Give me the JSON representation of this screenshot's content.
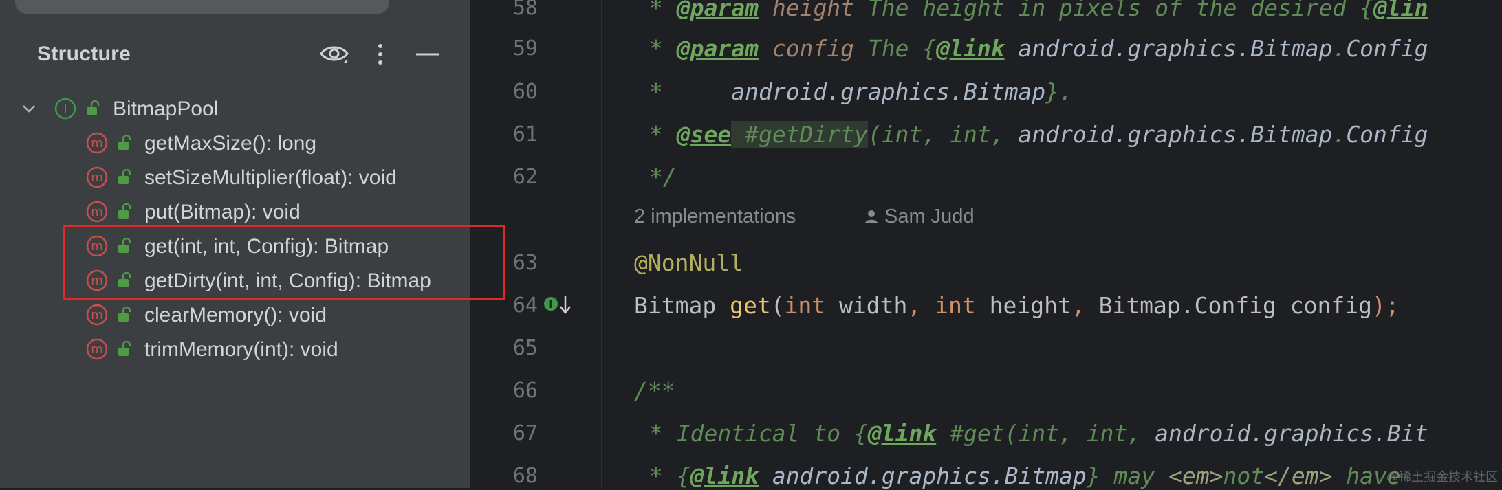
{
  "structure": {
    "title": "Structure",
    "root": {
      "label": "BitmapPool",
      "kind": "interface-icon"
    },
    "members": [
      {
        "label": "getMaxSize(): long"
      },
      {
        "label": "setSizeMultiplier(float): void"
      },
      {
        "label": "put(Bitmap): void"
      },
      {
        "label": "get(int, int, Config): Bitmap"
      },
      {
        "label": "getDirty(int, int, Config): Bitmap"
      },
      {
        "label": "clearMemory(): void"
      },
      {
        "label": "trimMemory(int): void"
      }
    ],
    "highlighted_members": [
      "get(int, int, Config): Bitmap",
      "getDirty(int, int, Config): Bitmap"
    ]
  },
  "editor": {
    "line_numbers": [
      "58",
      "59",
      "60",
      "61",
      "62",
      "63",
      "64",
      "65",
      "66",
      "67",
      "68"
    ],
    "inlay": {
      "implementations": "2 implementations",
      "author": "Sam Judd"
    },
    "lines": {
      "l58": {
        "star": "* ",
        "tag": "@param",
        "name": " height",
        "text": " The height in pixels of the desired {",
        "tag2": "@lin"
      },
      "l59": {
        "star": "* ",
        "tag": "@param",
        "name": " config",
        "text": " The {",
        "tag2": "@link",
        "ref": " android.graphics.Bitmap",
        "dot": ".",
        "ref2": "Config"
      },
      "l60": {
        "star": "*     ",
        "ref": "android.graphics.Bitmap",
        "end": "}."
      },
      "l61": {
        "star": "* ",
        "tag": "@see",
        "text": " #getDirty",
        "rest": "(int, int, ",
        "ref": "android.graphics.Bitmap",
        "dot": ".",
        "ref2": "Config"
      },
      "l62": {
        "text": "*/"
      },
      "l63": {
        "annotation": "@NonNull"
      },
      "l64": {
        "type": "Bitmap ",
        "method": "get",
        "p1": "(",
        "k1": "int",
        "a1": " width",
        "c1": ", ",
        "k2": "int",
        "a2": " height",
        "c2": ", ",
        "t3": "Bitmap.Config config",
        "end": ");"
      },
      "l66": {
        "text": "/**"
      },
      "l67": {
        "star": "* Identical to {",
        "tag": "@link",
        "text": " #get(int, int, ",
        "ref": "android.graphics.Bit"
      },
      "l68": {
        "star": "* {",
        "tag": "@link",
        "ref": " android.graphics.Bitmap",
        "end": "} may ",
        "html1": "<em>",
        "word": "not",
        "html2": "</em>",
        "tail": " have"
      }
    }
  },
  "watermark": "@稀土掘金技术社区",
  "colors": {
    "highlight_border": "#e02828",
    "method_icon": "#c94f4f",
    "interface_icon": "#3d9a4a",
    "lock": "#4f9a45"
  }
}
